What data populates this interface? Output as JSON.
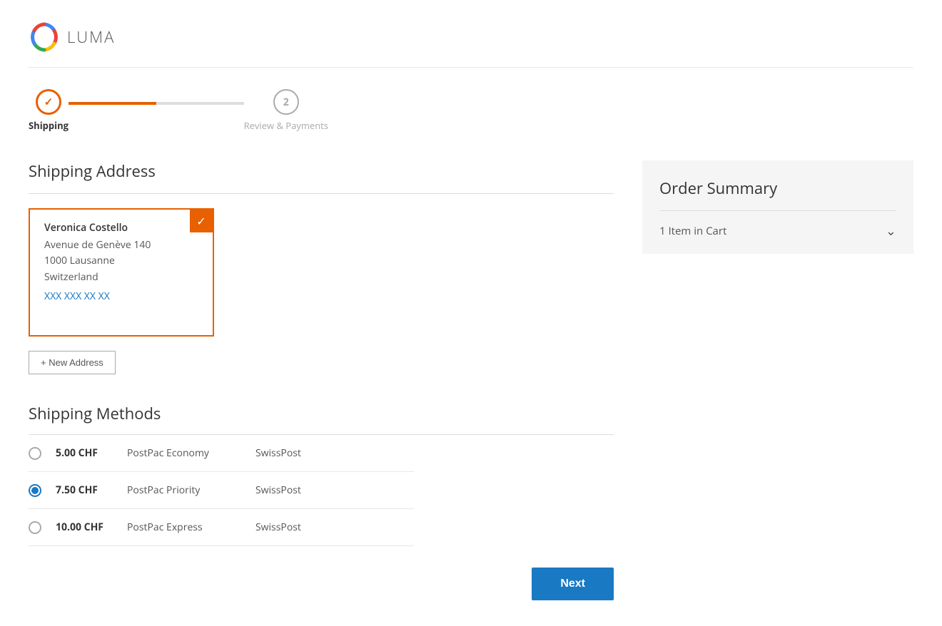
{
  "header": {
    "logo_text": "LUMA"
  },
  "progress": {
    "step1_label": "Shipping",
    "step2_label": "Review & Payments",
    "step2_number": "2"
  },
  "shipping_address": {
    "section_title": "Shipping Address",
    "address": {
      "name": "Veronica Costello",
      "street": "Avenue de Genève 140",
      "city_zip": "1000 Lausanne",
      "country": "Switzerland",
      "phone": "XXX XXX XX XX"
    },
    "new_address_button": "+ New Address"
  },
  "shipping_methods": {
    "section_title": "Shipping Methods",
    "methods": [
      {
        "price": "5.00 CHF",
        "name": "PostPac Economy",
        "carrier": "SwissPost",
        "selected": false
      },
      {
        "price": "7.50 CHF",
        "name": "PostPac Priority",
        "carrier": "SwissPost",
        "selected": true
      },
      {
        "price": "10.00 CHF",
        "name": "PostPac Express",
        "carrier": "SwissPost",
        "selected": false
      }
    ]
  },
  "next_button": "Next",
  "order_summary": {
    "title": "Order Summary",
    "cart_label": "1 Item in Cart"
  },
  "colors": {
    "orange": "#e86000",
    "blue": "#1979c3"
  }
}
